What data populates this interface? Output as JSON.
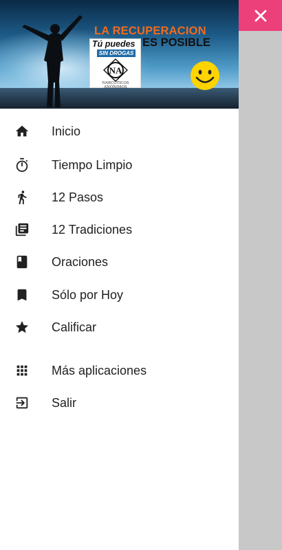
{
  "banner": {
    "line1": "LA RECUPERACION",
    "line2": "ES POSIBLE",
    "card_line1": "Tú puedes",
    "card_line2": "SIN DROGAS",
    "card_logo": "NA",
    "card_line3": "NARCÓTICOS ANÓNIMOS"
  },
  "close_icon": "close-icon",
  "colors": {
    "accent": "#ec407a",
    "text": "#212121",
    "icon": "#212121",
    "title_orange": "#f26b1d"
  },
  "menu": [
    {
      "label": "Inicio",
      "icon": "home-icon"
    },
    {
      "label": "Tiempo Limpio",
      "icon": "timer-icon"
    },
    {
      "label": "12 Pasos",
      "icon": "walking-person-icon"
    },
    {
      "label": "12 Tradiciones",
      "icon": "library-books-icon"
    },
    {
      "label": "Oraciones",
      "icon": "book-icon"
    },
    {
      "label": "Sólo por Hoy",
      "icon": "bookmark-icon"
    },
    {
      "label": "Calificar",
      "icon": "star-icon"
    },
    {
      "label": "Más aplicaciones",
      "icon": "apps-grid-icon"
    },
    {
      "label": "Salir",
      "icon": "exit-icon"
    }
  ]
}
